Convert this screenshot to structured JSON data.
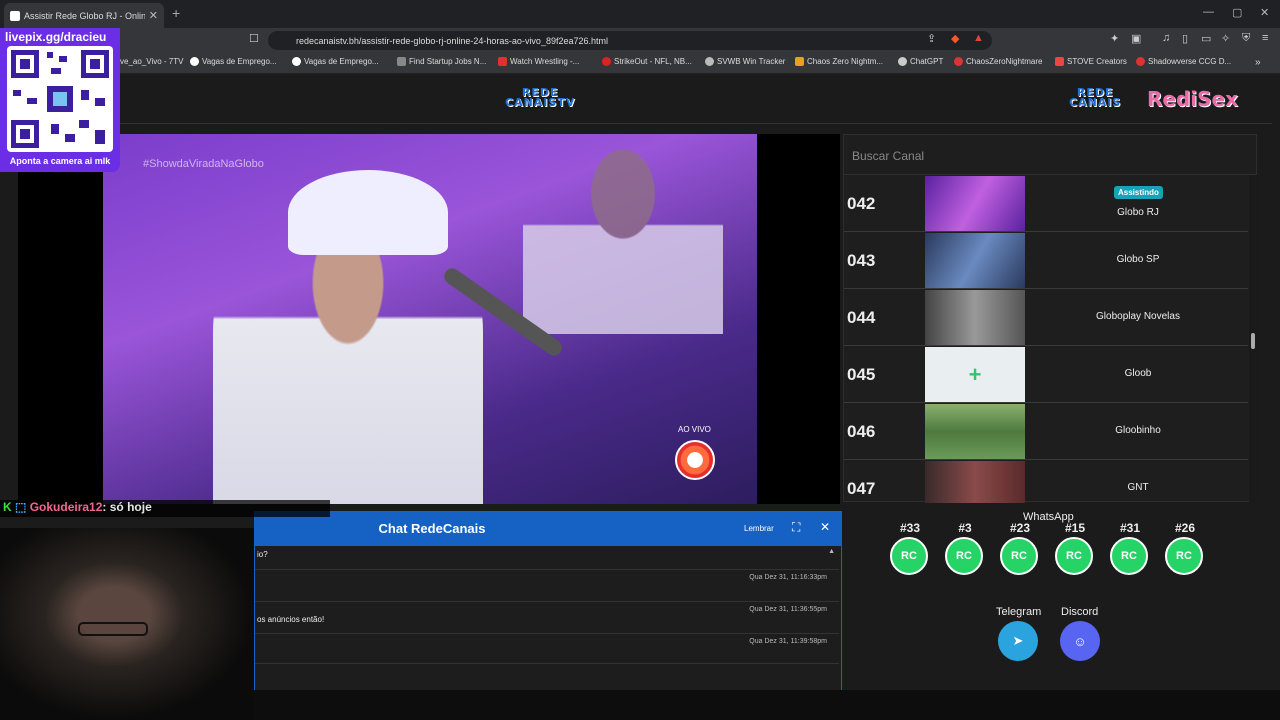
{
  "browser": {
    "tab_title": "Assistir Rede Globo RJ - Onlin",
    "url": "redecanaistv.bh/assistir-rede-globo-rj-online-24-horas-ao-vivo_89f2ea726.html",
    "bookmarks": [
      "ve_ao_Vivo - 7TV",
      "Vagas de Emprego...",
      "Vagas de Emprego...",
      "Find Startup Jobs N...",
      "Watch Wrestling -...",
      "StrikeOut - NFL, NB...",
      "SVWB Win Tracker",
      "Chaos Zero Nightm...",
      "ChatGPT",
      "ChaosZeroNightmare",
      "STOVE Creators",
      "Shadowverse CCG D..."
    ]
  },
  "site": {
    "logo_main_line1": "REDE",
    "logo_main_line2": "CANAISTV",
    "logo_right_line1": "REDE",
    "logo_right_line2": "CANAIS",
    "logo_right_2": "RediSex"
  },
  "player": {
    "hashtag": "#ShowdaViradaNaGlobo",
    "live_label": "AO VIVO"
  },
  "channels": {
    "search_placeholder": "Buscar Canal",
    "watching_badge": "Assistindo",
    "items": [
      {
        "num": "042",
        "name": "Globo RJ",
        "thumb": "#8a3ccf"
      },
      {
        "num": "043",
        "name": "Globo SP",
        "thumb": "#3a4f7a"
      },
      {
        "num": "044",
        "name": "Globoplay Novelas",
        "thumb": "#6a6a6a"
      },
      {
        "num": "045",
        "name": "Gloob",
        "thumb": "#e8eef0"
      },
      {
        "num": "046",
        "name": "Gloobinho",
        "thumb": "#5e8a4e"
      },
      {
        "num": "047",
        "name": "GNT",
        "thumb": "#6b3a3a"
      }
    ]
  },
  "whatsapp": {
    "label": "WhatsApp",
    "groups": [
      "#33",
      "#3",
      "#23",
      "#15",
      "#31",
      "#26"
    ],
    "icon_text": "RC"
  },
  "social": {
    "telegram": "Telegram",
    "discord": "Discord"
  },
  "chat": {
    "title": "Chat RedeCanais",
    "remember": "Lembrar",
    "messages": [
      {
        "text": "io?",
        "time": ""
      },
      {
        "text": "",
        "time": "Qua Dez 31, 11:16:33pm"
      },
      {
        "text": "os anúncios então!",
        "time": "Qua Dez 31, 11:36:55pm"
      },
      {
        "text": "",
        "time": "Qua Dez 31, 11:39:58pm"
      }
    ]
  },
  "overlay": {
    "qr_link": "livepix.gg/dracieu",
    "qr_caption": "Aponta a camera ai mlk",
    "chat_user": "Gokudeira12",
    "chat_text": ": só hoje"
  }
}
